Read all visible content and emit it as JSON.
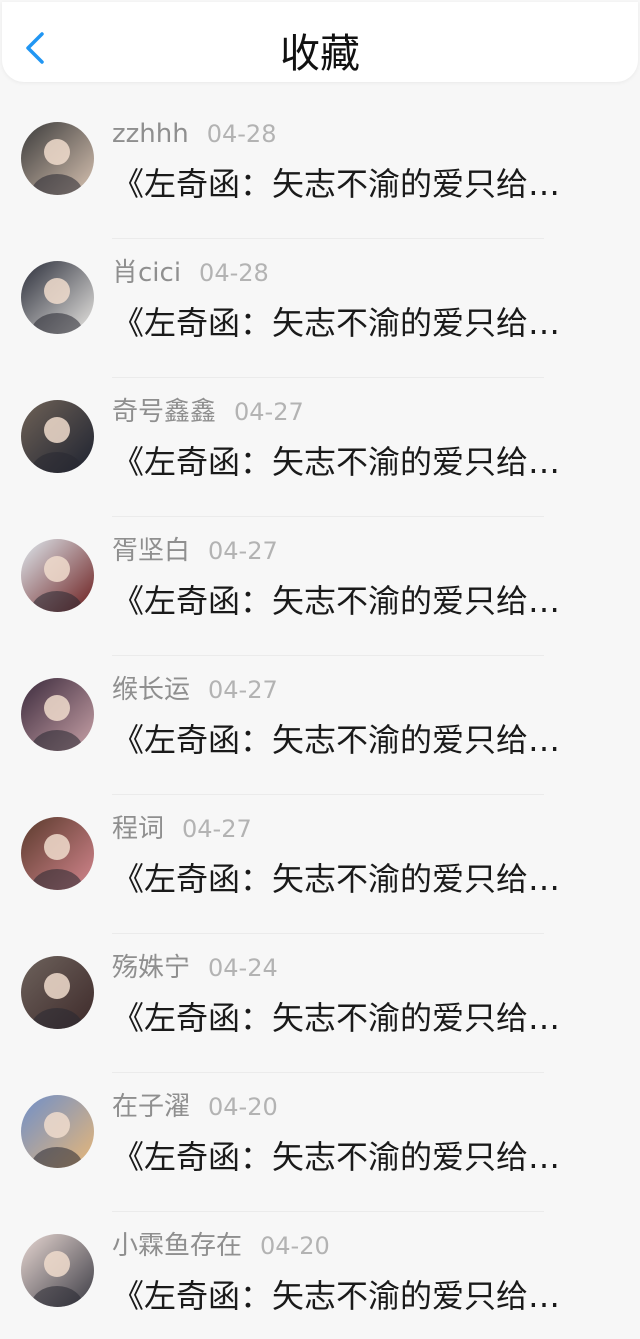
{
  "header": {
    "title": "收藏",
    "back_icon": "chevron-left-icon",
    "accent_color": "#2196f3"
  },
  "items": [
    {
      "name": "zzhhh",
      "date": "04-28",
      "title": "《左奇函：矢志不渝的爱只给…",
      "avatar_colors": [
        "#3a3a3a",
        "#d8c3b2"
      ]
    },
    {
      "name": "肖cici",
      "date": "04-28",
      "title": "《左奇函：矢志不渝的爱只给…",
      "avatar_colors": [
        "#2b2e3a",
        "#e9e7e3"
      ]
    },
    {
      "name": "奇号鑫鑫",
      "date": "04-27",
      "title": "《左奇函：矢志不渝的爱只给…",
      "avatar_colors": [
        "#6f6257",
        "#1d2230"
      ]
    },
    {
      "name": "胥坚白",
      "date": "04-27",
      "title": "《左奇函：矢志不渝的爱只给…",
      "avatar_colors": [
        "#dfe9ef",
        "#6b1c1c"
      ]
    },
    {
      "name": "缑长运",
      "date": "04-27",
      "title": "《左奇函：矢志不渝的爱只给…",
      "avatar_colors": [
        "#3b2a3c",
        "#c9a2a8"
      ]
    },
    {
      "name": "程词",
      "date": "04-27",
      "title": "《左奇函：矢志不渝的爱只给…",
      "avatar_colors": [
        "#5a3a2c",
        "#d4868e"
      ]
    },
    {
      "name": "殇姝宁",
      "date": "04-24",
      "title": "《左奇函：矢志不渝的爱只给…",
      "avatar_colors": [
        "#6d625c",
        "#3e2a2a"
      ]
    },
    {
      "name": "在子濯",
      "date": "04-20",
      "title": "《左奇函：矢志不渝的爱只给…",
      "avatar_colors": [
        "#6f8fc9",
        "#e8b777"
      ]
    },
    {
      "name": "小霖鱼存在",
      "date": "04-20",
      "title": "《左奇函：矢志不渝的爱只给…",
      "avatar_colors": [
        "#e7d7d2",
        "#3b3b44"
      ]
    }
  ]
}
